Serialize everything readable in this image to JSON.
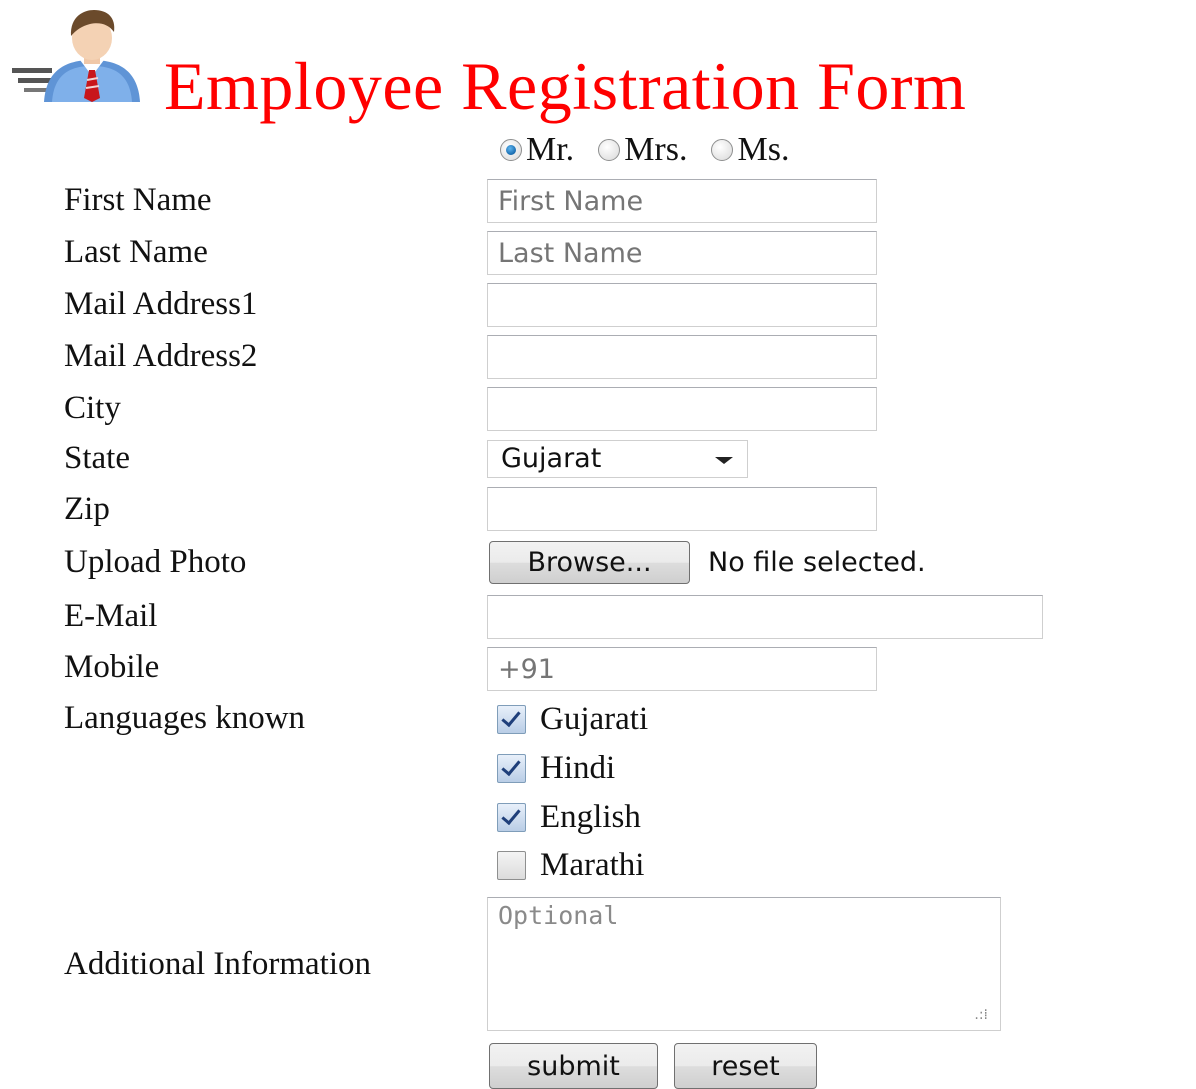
{
  "header": {
    "title": "Employee Registration Form",
    "logo_icon": "businessman-icon"
  },
  "salutation": {
    "options": [
      {
        "label": "Mr.",
        "checked": true
      },
      {
        "label": "Mrs.",
        "checked": false
      },
      {
        "label": "Ms.",
        "checked": false
      }
    ]
  },
  "fields": {
    "first_name": {
      "label": "First Name",
      "value": "",
      "placeholder": "First Name"
    },
    "last_name": {
      "label": "Last Name",
      "value": "",
      "placeholder": "Last Name"
    },
    "mail_address1": {
      "label": "Mail Address1",
      "value": ""
    },
    "mail_address2": {
      "label": "Mail Address2",
      "value": ""
    },
    "city": {
      "label": "City",
      "value": ""
    },
    "state": {
      "label": "State",
      "value": "Gujarat"
    },
    "zip": {
      "label": "Zip",
      "value": ""
    },
    "upload_photo": {
      "label": "Upload Photo",
      "button": "Browse...",
      "status": "No file selected."
    },
    "email": {
      "label": "E-Mail",
      "value": ""
    },
    "mobile": {
      "label": "Mobile",
      "value": "",
      "placeholder": "+91"
    }
  },
  "languages": {
    "label": "Languages known",
    "options": [
      {
        "label": "Gujarati",
        "checked": true
      },
      {
        "label": "Hindi",
        "checked": true
      },
      {
        "label": "English",
        "checked": true
      },
      {
        "label": "Marathi",
        "checked": false
      }
    ]
  },
  "additional": {
    "label": "Additional Information",
    "placeholder": "Optional"
  },
  "actions": {
    "submit": "submit",
    "reset": "reset"
  },
  "colors": {
    "title": "#ff0000",
    "radio_selected": "#1c6fb3",
    "checkmark": "#1f3f7a"
  }
}
